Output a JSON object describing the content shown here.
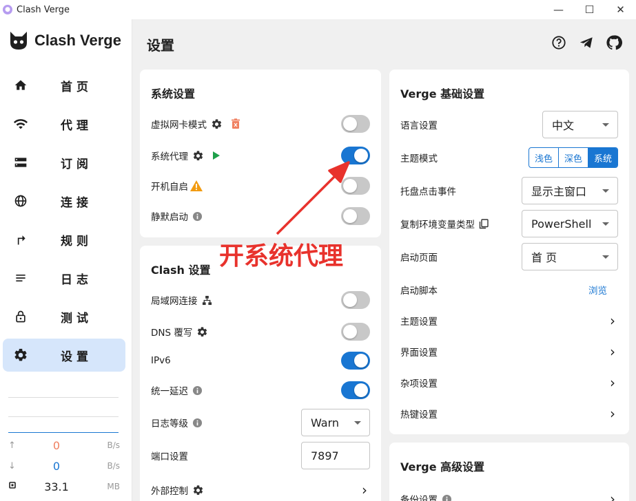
{
  "window": {
    "title": "Clash Verge",
    "controls": [
      "—",
      "☐",
      "✕"
    ]
  },
  "sidebar": {
    "logo_text": "Clash Verge",
    "items": [
      {
        "label": "首页",
        "icon": "home-icon",
        "active": false
      },
      {
        "label": "代理",
        "icon": "wifi-icon",
        "active": false
      },
      {
        "label": "订阅",
        "icon": "storage-icon",
        "active": false
      },
      {
        "label": "连接",
        "icon": "globe-icon",
        "active": false
      },
      {
        "label": "规则",
        "icon": "fork-arrow-icon",
        "active": false
      },
      {
        "label": "日志",
        "icon": "list-lines-icon",
        "active": false
      },
      {
        "label": "测试",
        "icon": "lock-icon",
        "active": false
      },
      {
        "label": "设置",
        "icon": "gear-icon",
        "active": true
      }
    ],
    "traffic": {
      "up": {
        "arrow": "↑",
        "value": "0",
        "unit": "B/s",
        "color": "#f08060"
      },
      "down": {
        "arrow": "↓",
        "value": "0",
        "unit": "B/s",
        "color": "#1976d2"
      },
      "memory": {
        "value": "33.1",
        "unit": "MB"
      }
    }
  },
  "header": {
    "title": "设置",
    "icons": [
      "help-icon",
      "telegram-icon",
      "github-icon"
    ]
  },
  "system_card": {
    "title": "系统设置",
    "rows": [
      {
        "label": "虚拟网卡模式",
        "on": false
      },
      {
        "label": "系统代理",
        "on": true
      },
      {
        "label": "开机自启",
        "on": false
      },
      {
        "label": "静默启动",
        "on": false
      }
    ]
  },
  "clash_card": {
    "title": "Clash 设置",
    "rows": {
      "lan": {
        "label": "局域网连接",
        "on": false
      },
      "dns": {
        "label": "DNS 覆写",
        "on": false
      },
      "ipv6": {
        "label": "IPv6",
        "on": true
      },
      "latency": {
        "label": "统一延迟",
        "on": true
      },
      "log_level": {
        "label": "日志等级",
        "value": "Warn"
      },
      "port": {
        "label": "端口设置",
        "value": "7897"
      },
      "ext": {
        "label": "外部控制"
      }
    }
  },
  "verge_card": {
    "title": "Verge 基础设置",
    "language": {
      "label": "语言设置",
      "value": "中文"
    },
    "theme_mode": {
      "label": "主题模式",
      "options": [
        "浅色",
        "深色",
        "系统"
      ],
      "selected": 2
    },
    "tray": {
      "label": "托盘点击事件",
      "value": "显示主窗口"
    },
    "copy_env": {
      "label": "复制环境变量类型",
      "value": "PowerShell"
    },
    "start_page": {
      "label": "启动页面",
      "value": "首 页"
    },
    "start_script": {
      "label": "启动脚本",
      "action": "浏览"
    },
    "theme_settings": {
      "label": "主题设置"
    },
    "ui_settings": {
      "label": "界面设置"
    },
    "misc_settings": {
      "label": "杂项设置"
    },
    "hotkey_settings": {
      "label": "热键设置"
    }
  },
  "verge_adv_card": {
    "title": "Verge 高级设置",
    "backup": {
      "label": "备份设置"
    }
  },
  "annotation": {
    "text": "开系统代理",
    "color": "#e8322c"
  },
  "colors": {
    "accent": "#1976d2",
    "active_nav": "#d6e6fb",
    "play_green": "#1ea04a",
    "warn_orange": "#f29b10",
    "delete_red": "#f08060"
  }
}
